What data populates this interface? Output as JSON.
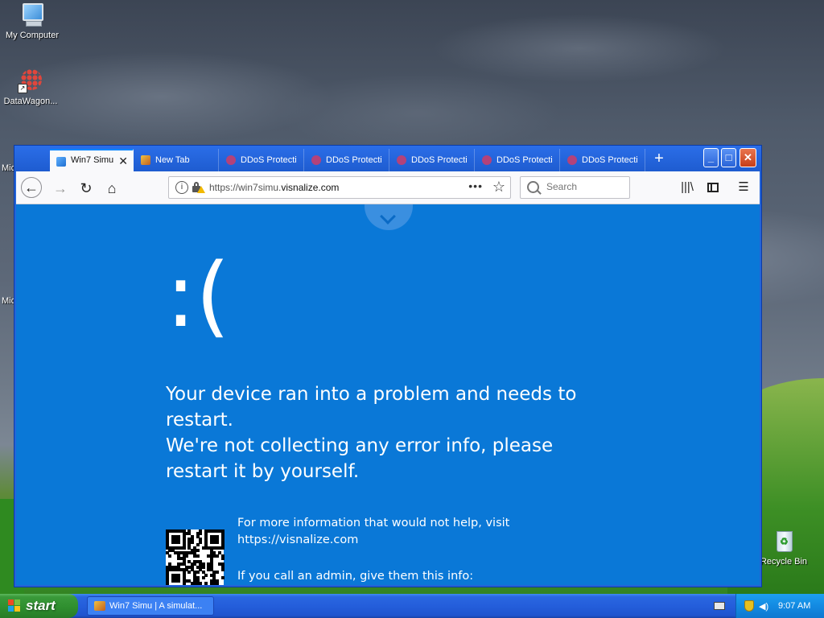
{
  "desktop": {
    "icons": [
      {
        "label": "My Computer"
      },
      {
        "label": "DataWagon..."
      },
      {
        "label": "Mic"
      },
      {
        "label": "Mic"
      },
      {
        "label": "Recycle Bin"
      }
    ]
  },
  "browser": {
    "tabs": [
      {
        "label": "Win7 Simu",
        "active": true,
        "close": "✕"
      },
      {
        "label": "New Tab"
      },
      {
        "label": "DDoS Protecti"
      },
      {
        "label": "DDoS Protecti"
      },
      {
        "label": "DDoS Protecti"
      },
      {
        "label": "DDoS Protecti"
      },
      {
        "label": "DDoS Protecti"
      }
    ],
    "new_tab": "+",
    "window_buttons": {
      "minimize": "_",
      "maximize": "□",
      "close": "✕"
    },
    "nav": {
      "back": "←",
      "forward": "→",
      "reload": "↻",
      "home": "⌂"
    },
    "url": {
      "prefix": "https://win7simu.",
      "domain": "visnalize.com",
      "more": "•••",
      "bookmark": "☆"
    },
    "search_placeholder": "Search",
    "toolbar": {
      "library": "|||\\",
      "menu": "☰"
    }
  },
  "page": {
    "sad_face": ":(",
    "message_line1": "Your device ran into a problem and needs to restart.",
    "message_line2": "We're not collecting any error info, please restart it by yourself.",
    "info_line1": "For more information that would not help, visit",
    "info_link": "https://visnalize.com",
    "info_admin": "If you call an admin, give them this info:"
  },
  "taskbar": {
    "start_label": "start",
    "task_item": "Win7 Simu | A simulat...",
    "clock": "9:07 AM"
  },
  "colors": {
    "bsod_blue": "#0a78d7",
    "xp_taskbar": "#245edb",
    "start_green": "#3a9a3a"
  }
}
